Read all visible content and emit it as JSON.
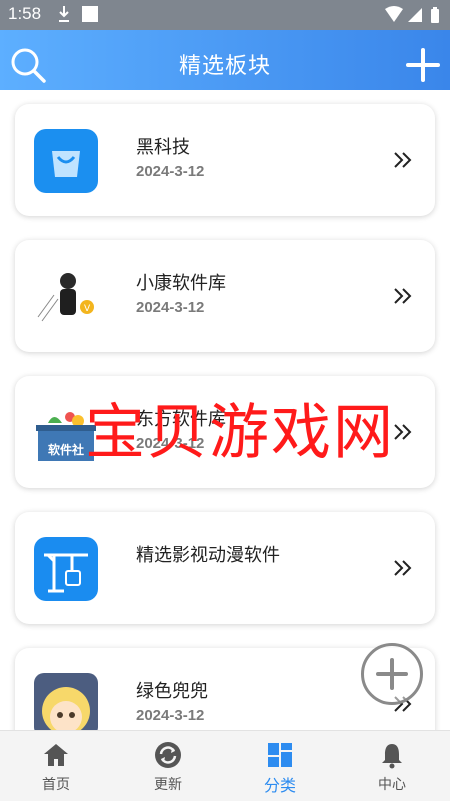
{
  "status_bar": {
    "time": "1:58"
  },
  "header": {
    "title": "精选板块"
  },
  "watermark": "宝贝游戏网",
  "items": [
    {
      "title": "黑科技",
      "date": "2024-3-12",
      "icon": "shopping-bag-icon"
    },
    {
      "title": "小康软件库",
      "date": "2024-3-12",
      "icon": "person-avatar-icon"
    },
    {
      "title": "东方软件库",
      "date": "2024-3-12",
      "icon": "android-box-icon",
      "icon_text": "软件社"
    },
    {
      "title": "精选影视动漫软件",
      "date": "",
      "icon": "app-store-crane-icon"
    },
    {
      "title": "绿色兜兜",
      "date": "2024-3-12",
      "icon": "anime-avatar-icon"
    }
  ],
  "tabs": [
    {
      "label": "首页",
      "icon": "home-icon",
      "active": false
    },
    {
      "label": "更新",
      "icon": "refresh-icon",
      "active": false
    },
    {
      "label": "分类",
      "icon": "grid-icon",
      "active": true
    },
    {
      "label": "中心",
      "icon": "bell-icon",
      "active": false
    }
  ],
  "colors": {
    "accent": "#2d8cf0",
    "header_start": "#5dafff",
    "header_end": "#3a86ea",
    "watermark": "#ff1a1a"
  }
}
